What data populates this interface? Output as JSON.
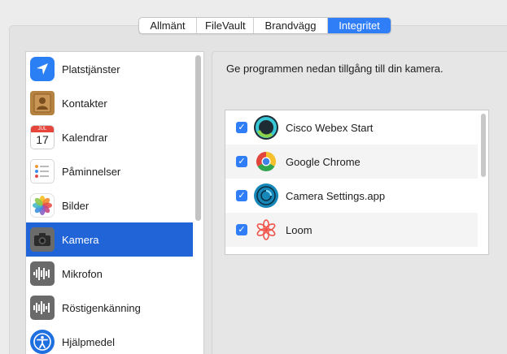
{
  "tabs": [
    {
      "label": "Allmänt",
      "active": false
    },
    {
      "label": "FileVault",
      "active": false
    },
    {
      "label": "Brandvägg",
      "active": false
    },
    {
      "label": "Integritet",
      "active": true
    }
  ],
  "sidebar": {
    "items": [
      {
        "label": "Platstjänster",
        "icon": "location-arrow-icon"
      },
      {
        "label": "Kontakter",
        "icon": "contacts-book-icon"
      },
      {
        "label": "Kalendrar",
        "icon": "calendar-icon",
        "calendar_month": "JUL",
        "calendar_day": "17"
      },
      {
        "label": "Påminnelser",
        "icon": "reminders-list-icon"
      },
      {
        "label": "Bilder",
        "icon": "photos-flower-icon"
      },
      {
        "label": "Kamera",
        "icon": "camera-icon",
        "selected": true
      },
      {
        "label": "Mikrofon",
        "icon": "microphone-waveform-icon"
      },
      {
        "label": "Röstigenkänning",
        "icon": "speech-waveform-icon"
      },
      {
        "label": "Hjälpmedel",
        "icon": "accessibility-person-icon"
      }
    ]
  },
  "main": {
    "description": "Ge programmen nedan tillgång till din kamera.",
    "apps": [
      {
        "label": "Cisco Webex Start",
        "icon": "webex-icon",
        "checked": true
      },
      {
        "label": "Google Chrome",
        "icon": "chrome-icon",
        "checked": true
      },
      {
        "label": "Camera Settings.app",
        "icon": "camera-settings-icon",
        "checked": true
      },
      {
        "label": "Loom",
        "icon": "loom-icon",
        "checked": true
      }
    ]
  },
  "colors": {
    "accent": "#2f7ef7",
    "selection": "#2164d7"
  }
}
